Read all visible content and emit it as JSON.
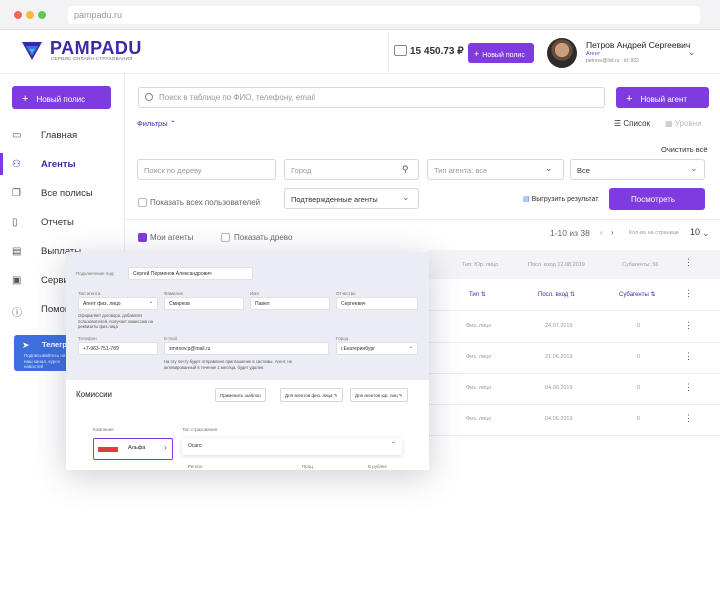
{
  "browser": {
    "url": "pampadu.ru"
  },
  "logo": {
    "name": "PAMPADU",
    "tagline": "СЕРВИС ОНЛАЙН-СТРАХОВАНИЯ"
  },
  "header": {
    "balance": "15 450.73 ₽",
    "new_policy_label": "Новый полис",
    "user_name": "Петров Андрей Сергеевич",
    "user_role": "Агент",
    "user_meta": "petrovv@list.ru · id: 932"
  },
  "sidebar": {
    "new_policy_label": "Новый полис",
    "items": [
      {
        "label": "Главная",
        "icon": "monitor-icon"
      },
      {
        "label": "Агенты",
        "icon": "user-icon"
      },
      {
        "label": "Все полисы",
        "icon": "copy-icon"
      },
      {
        "label": "Отчеты",
        "icon": "clipboard-icon"
      },
      {
        "label": "Выплаты",
        "icon": "card-icon"
      },
      {
        "label": "Сервисы",
        "icon": "briefcase-icon"
      },
      {
        "label": "Помощь",
        "icon": "info-icon"
      }
    ],
    "telegram_title": "Телеграм",
    "telegram_text": "Подписывайтесь на наш канал, курсе новостей"
  },
  "main": {
    "search_placeholder": "Поиск в таблице по ФИО, телефону, email",
    "new_agent_label": "Новый агент",
    "filters_label": "Фильтры",
    "view_list": "Список",
    "view_levels": "Уровни",
    "clear_all": "Очистить всё",
    "filter_tree_placeholder": "Поиск по дереву",
    "filter_city_placeholder": "Город",
    "filter_agent_type": "Тип агента: все",
    "filter_all": "Все",
    "show_all_users": "Показать всех пользователей",
    "confirmed_agents": "Подтвержденные агенты",
    "export_label": "Выгрузить результат",
    "view_button": "Посмотреть",
    "my_agents": "Мои агенты",
    "show_tree": "Показать древо",
    "range": "1-10 из 38",
    "per_page_label": "Кол-во на странице",
    "per_page_value": "10"
  },
  "table": {
    "summary_type": "Тип: Юр. лицо",
    "summary_last_login": "Посл. вход 12.08.2019",
    "summary_subagents": "Субагенты: 56",
    "headers": {
      "type": "Тип",
      "last_login": "Посл. вход",
      "subagents": "Субагенты"
    },
    "rows": [
      {
        "type": "Физ. лицо",
        "last_login": "24.07.2019",
        "subagents": "0"
      },
      {
        "type": "Физ. лицо",
        "last_login": "21.06.2019",
        "subagents": "0"
      },
      {
        "type": "Физ. лицо",
        "last_login": "04.06.2019",
        "subagents": "0"
      },
      {
        "type": "Физ. лицо",
        "last_login": "04.06.2019",
        "subagents": "0"
      }
    ]
  },
  "modal": {
    "connected_label": "Подключение под:",
    "connected_value": "Сергей Перменов Александрович",
    "agent_type_label": "Тип агента",
    "agent_type_value": "Агент физ. лицо",
    "agent_type_note": "Оформляет договора, добавляет пользователей, получает комиссию на реквизиты физ.лица",
    "surname_label": "Фамилия",
    "surname_value": "Смирнов",
    "name_label": "Имя",
    "name_value": "Павел",
    "patronymic_label": "Отчество",
    "patronymic_value": "Сергеевич",
    "phone_label": "Телефон",
    "phone_value": "+7-963-751-789",
    "email_label": "E-mail",
    "email_value": "smirnov.p@mail.ru",
    "email_note": "На эту почту будет отправлено приглашение в системы. Агент, не активированный в течение 1 месяца, будет удален.",
    "city_label": "Город",
    "city_value": "г.Екатеринбург",
    "commissions_title": "Комиссии",
    "apply_template": "Применить шаблон",
    "for_individuals": "Для агентов физ. лица",
    "for_legal": "Для агентов юр. лиц",
    "company_label": "Компания",
    "company_value": "Альфа",
    "insurance_type_label": "Тип страхования",
    "insurance_type_value": "Осаго",
    "col_region": "Регион",
    "col_percent": "Проц.",
    "col_rub": "В рублях"
  }
}
